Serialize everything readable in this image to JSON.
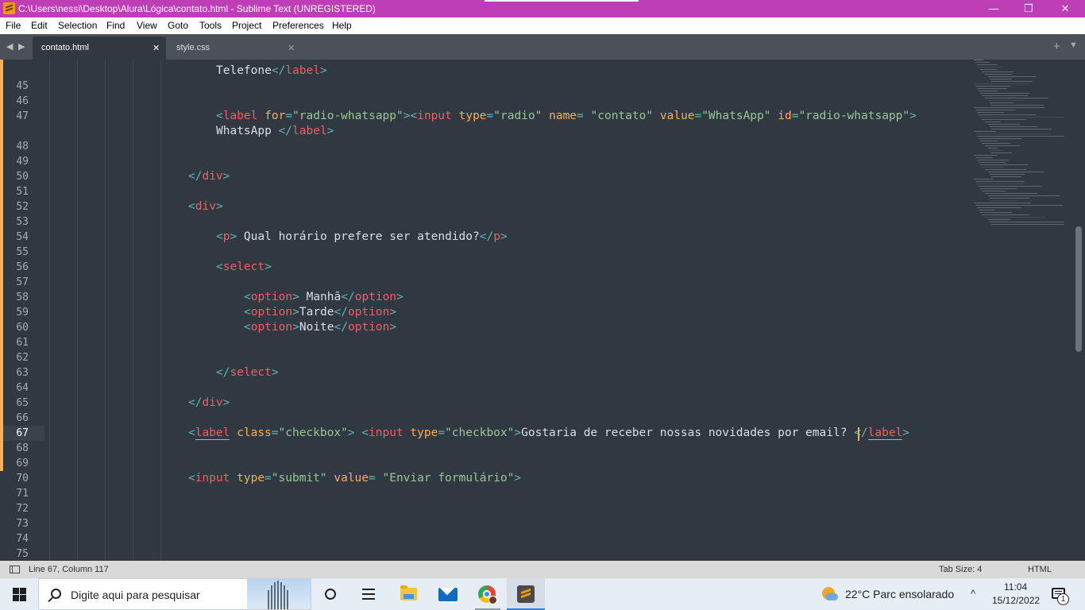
{
  "window": {
    "title": "C:\\Users\\nessi\\Desktop\\Alura\\Lógica\\contato.html - Sublime Text (UNREGISTERED)",
    "minimize": "—",
    "maximize": "❐",
    "close": "✕"
  },
  "menu": {
    "items": [
      "File",
      "Edit",
      "Selection",
      "Find",
      "View",
      "Goto",
      "Tools",
      "Project",
      "Preferences",
      "Help"
    ]
  },
  "tabs": [
    {
      "label": "contato.html",
      "active": true
    },
    {
      "label": "style.css",
      "active": false
    }
  ],
  "tabbar": {
    "close_glyph": "✕",
    "plus_glyph": "+",
    "dropdown_glyph": "▼",
    "nav_left": "◀",
    "nav_right": "▶"
  },
  "editor": {
    "current_line": 67,
    "gutter_numbers": [
      "45",
      "46",
      "47",
      "48",
      "49",
      "50",
      "51",
      "52",
      "53",
      "54",
      "55",
      "56",
      "57",
      "58",
      "59",
      "60",
      "61",
      "62",
      "63",
      "64",
      "65",
      "66",
      "67",
      "68",
      "69",
      "70",
      "71",
      "72",
      "73",
      "74",
      "75"
    ],
    "lines": {
      "l44b": {
        "text": "Telefone",
        "close": "label"
      },
      "l47": {
        "tag": "label",
        "for_attr": "for",
        "for_val": "\"radio-whatsapp\"",
        "input": "input",
        "type_attr": "type",
        "type_val": "\"radio\"",
        "name_attr": "name",
        "name_val": "\"contato\"",
        "value_attr": "value",
        "value_val": "\"WhatsApp\"",
        "id_attr": "id",
        "id_val": "\"radio-whatsapp\""
      },
      "l47b": {
        "text": "WhatsApp ",
        "close": "label"
      },
      "l50": {
        "close": "div"
      },
      "l52": {
        "open": "div"
      },
      "l54": {
        "open": "p",
        "text": " Qual horário prefere ser atendido?",
        "close": "p"
      },
      "l56": {
        "open": "select"
      },
      "l58": {
        "open": "option",
        "text": " Manhã",
        "close": "option"
      },
      "l59": {
        "open": "option",
        "text": "Tarde",
        "close": "option"
      },
      "l60": {
        "open": "option",
        "text": "Noite",
        "close": "option"
      },
      "l63": {
        "close": "select"
      },
      "l65": {
        "close": "div"
      },
      "l67": {
        "tag": "label",
        "class_attr": "class",
        "class_val": "\"checkbox\"",
        "input": "input",
        "type_attr": "type",
        "type_val": "\"checkbox\"",
        "text": "Gostaria de receber nossas novidades por email? ",
        "close": "label"
      },
      "l70": {
        "input": "input",
        "type_attr": "type",
        "type_val": "\"submit\"",
        "value_attr": "value",
        "value_val": "\"Enviar formulário\""
      }
    }
  },
  "status": {
    "position": "Line 67, Column 117",
    "tab_size": "Tab Size: 4",
    "syntax": "HTML"
  },
  "taskbar": {
    "search_placeholder": "Digite aqui para pesquisar",
    "weather": "22°C  Parc ensolarado",
    "chevron": "^",
    "time": "11:04",
    "date": "15/12/2022",
    "notification_count": "1",
    "icons": [
      "windows-start-icon",
      "search-icon",
      "task-view-icon",
      "widgets-icon",
      "file-explorer-icon",
      "mail-icon",
      "chrome-icon",
      "sublime-text-icon",
      "weather-icon",
      "notification-icon"
    ]
  },
  "colors": {
    "titlebar": "#bd3eb5",
    "editor_bg": "#303841",
    "tag": "#ec5f66",
    "punct": "#5fb4b4",
    "attr": "#f9ae58",
    "string": "#99c794",
    "text": "#d8dee9"
  }
}
